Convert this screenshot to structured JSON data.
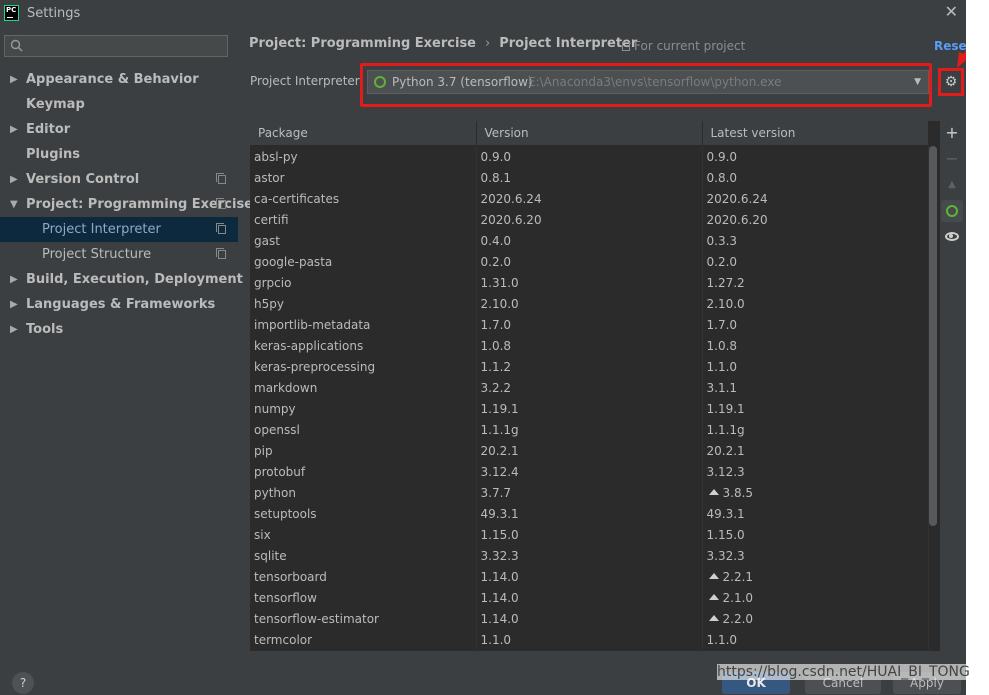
{
  "window": {
    "title": "Settings",
    "app_icon_text": "PC"
  },
  "sidebar": {
    "search_placeholder": "",
    "items": [
      {
        "label": "Appearance & Behavior",
        "arrow": "▶",
        "bold": true
      },
      {
        "label": "Keymap",
        "arrow": "",
        "bold": true
      },
      {
        "label": "Editor",
        "arrow": "▶",
        "bold": true
      },
      {
        "label": "Plugins",
        "arrow": "",
        "bold": true
      },
      {
        "label": "Version Control",
        "arrow": "▶",
        "bold": true,
        "copy_icon": true
      },
      {
        "label": "Project: Programming Exercise",
        "arrow": "▼",
        "bold": true,
        "copy_icon": true
      },
      {
        "label": "Project Interpreter",
        "arrow": "",
        "sub": true,
        "selected": true,
        "copy_icon": true
      },
      {
        "label": "Project Structure",
        "arrow": "",
        "sub": true,
        "copy_icon": true
      },
      {
        "label": "Build, Execution, Deployment",
        "arrow": "▶",
        "bold": true
      },
      {
        "label": "Languages & Frameworks",
        "arrow": "▶",
        "bold": true
      },
      {
        "label": "Tools",
        "arrow": "▶",
        "bold": true
      }
    ]
  },
  "breadcrumb": {
    "project": "Project: Programming Exercise",
    "separator": "›",
    "page": "Project Interpreter"
  },
  "for_current_project": "For current project",
  "reset_label": "Rese",
  "interpreter": {
    "label": "Project Interpreter:",
    "name": "Python 3.7 (tensorflow)",
    "path": "E:\\Anaconda3\\envs\\tensorflow\\python.exe",
    "dropdown_arrow": "▼"
  },
  "icons": {
    "gear": "⚙",
    "add": "+",
    "remove": "−",
    "upgrade": "▲",
    "help": "?",
    "search": "Q",
    "close": "✕"
  },
  "colors": {
    "highlight": "#e21b1b",
    "selection": "#0d293e",
    "ok": "#365880",
    "link": "#589df6"
  },
  "table": {
    "columns": [
      "Package",
      "Version",
      "Latest version"
    ],
    "rows": [
      {
        "package": "absl-py",
        "version": "0.9.0",
        "latest": "0.9.0",
        "upgrade": false
      },
      {
        "package": "astor",
        "version": "0.8.1",
        "latest": "0.8.0",
        "upgrade": false
      },
      {
        "package": "ca-certificates",
        "version": "2020.6.24",
        "latest": "2020.6.24",
        "upgrade": false
      },
      {
        "package": "certifi",
        "version": "2020.6.20",
        "latest": "2020.6.20",
        "upgrade": false
      },
      {
        "package": "gast",
        "version": "0.4.0",
        "latest": "0.3.3",
        "upgrade": false
      },
      {
        "package": "google-pasta",
        "version": "0.2.0",
        "latest": "0.2.0",
        "upgrade": false
      },
      {
        "package": "grpcio",
        "version": "1.31.0",
        "latest": "1.27.2",
        "upgrade": false
      },
      {
        "package": "h5py",
        "version": "2.10.0",
        "latest": "2.10.0",
        "upgrade": false
      },
      {
        "package": "importlib-metadata",
        "version": "1.7.0",
        "latest": "1.7.0",
        "upgrade": false
      },
      {
        "package": "keras-applications",
        "version": "1.0.8",
        "latest": "1.0.8",
        "upgrade": false
      },
      {
        "package": "keras-preprocessing",
        "version": "1.1.2",
        "latest": "1.1.0",
        "upgrade": false
      },
      {
        "package": "markdown",
        "version": "3.2.2",
        "latest": "3.1.1",
        "upgrade": false
      },
      {
        "package": "numpy",
        "version": "1.19.1",
        "latest": "1.19.1",
        "upgrade": false
      },
      {
        "package": "openssl",
        "version": "1.1.1g",
        "latest": "1.1.1g",
        "upgrade": false
      },
      {
        "package": "pip",
        "version": "20.2.1",
        "latest": "20.2.1",
        "upgrade": false
      },
      {
        "package": "protobuf",
        "version": "3.12.4",
        "latest": "3.12.3",
        "upgrade": false
      },
      {
        "package": "python",
        "version": "3.7.7",
        "latest": "3.8.5",
        "upgrade": true
      },
      {
        "package": "setuptools",
        "version": "49.3.1",
        "latest": "49.3.1",
        "upgrade": false
      },
      {
        "package": "six",
        "version": "1.15.0",
        "latest": "1.15.0",
        "upgrade": false
      },
      {
        "package": "sqlite",
        "version": "3.32.3",
        "latest": "3.32.3",
        "upgrade": false
      },
      {
        "package": "tensorboard",
        "version": "1.14.0",
        "latest": "2.2.1",
        "upgrade": true
      },
      {
        "package": "tensorflow",
        "version": "1.14.0",
        "latest": "2.1.0",
        "upgrade": true
      },
      {
        "package": "tensorflow-estimator",
        "version": "1.14.0",
        "latest": "2.2.0",
        "upgrade": true
      },
      {
        "package": "termcolor",
        "version": "1.1.0",
        "latest": "1.1.0",
        "upgrade": false
      }
    ]
  },
  "buttons": {
    "ok": "OK",
    "cancel": "Cancel",
    "apply": "Apply"
  },
  "watermark": "https://blog.csdn.net/HUAI_BI_TONG"
}
